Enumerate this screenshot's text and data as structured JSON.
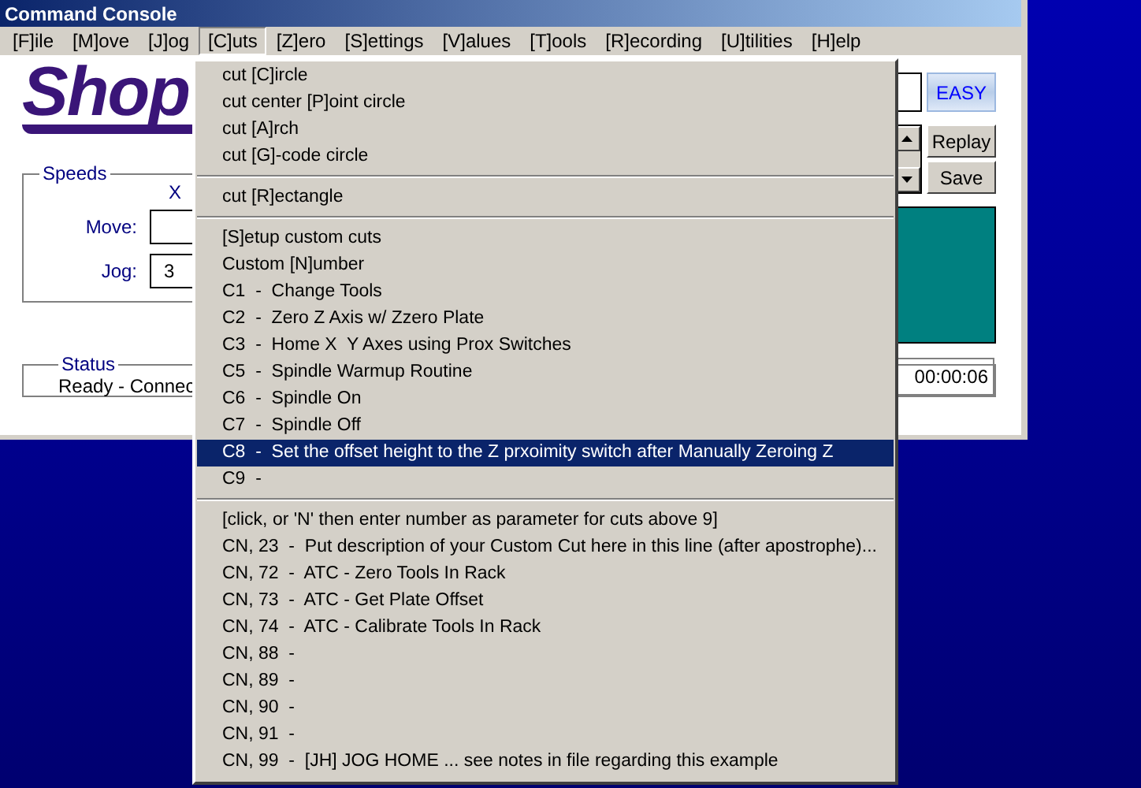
{
  "window": {
    "title": "Command Console"
  },
  "menu": [
    {
      "label": "[F]ile",
      "selected": false
    },
    {
      "label": "[M]ove",
      "selected": false
    },
    {
      "label": "[J]og",
      "selected": false
    },
    {
      "label": "[C]uts",
      "selected": true
    },
    {
      "label": "[Z]ero",
      "selected": false
    },
    {
      "label": "[S]ettings",
      "selected": false
    },
    {
      "label": "[V]alues",
      "selected": false
    },
    {
      "label": "[T]ools",
      "selected": false
    },
    {
      "label": "[R]ecording",
      "selected": false
    },
    {
      "label": "[U]tilities",
      "selected": false
    },
    {
      "label": "[H]elp",
      "selected": false
    }
  ],
  "logo": {
    "text": "Shop"
  },
  "speeds": {
    "title": "Speeds",
    "column_label": "X",
    "rows": [
      {
        "label": "Move:"
      },
      {
        "label": "Jog:",
        "value": "3"
      }
    ]
  },
  "mode_button": "EASY",
  "buttons": [
    "Replay",
    "Save"
  ],
  "status": {
    "title": "Status",
    "text": "Ready - Connec",
    "timer": "00:00:06"
  },
  "dropdown": [
    {
      "kind": "item",
      "label": "cut [C]ircle",
      "selected": false
    },
    {
      "kind": "item",
      "label": "cut center [P]oint circle",
      "selected": false
    },
    {
      "kind": "item",
      "label": "cut [A]rch",
      "selected": false
    },
    {
      "kind": "item",
      "label": "cut [G]-code circle",
      "selected": false
    },
    {
      "kind": "separator"
    },
    {
      "kind": "item",
      "label": "cut [R]ectangle",
      "selected": false
    },
    {
      "kind": "separator"
    },
    {
      "kind": "item",
      "label": "[S]etup custom cuts",
      "selected": false
    },
    {
      "kind": "item",
      "label": "Custom [N]umber",
      "selected": false
    },
    {
      "kind": "item",
      "label": "C1  -  Change Tools",
      "selected": false
    },
    {
      "kind": "item",
      "label": "C2  -  Zero Z Axis w/ Zzero Plate",
      "selected": false
    },
    {
      "kind": "item",
      "label": "C3  -  Home X  Y Axes using Prox Switches",
      "selected": false
    },
    {
      "kind": "item",
      "label": "C5  -  Spindle Warmup Routine",
      "selected": false
    },
    {
      "kind": "item",
      "label": "C6  -  Spindle On",
      "selected": false
    },
    {
      "kind": "item",
      "label": "C7  -  Spindle Off",
      "selected": false
    },
    {
      "kind": "item",
      "label": "C8  -  Set the offset height to the Z prxoimity switch after Manually Zeroing Z",
      "selected": true
    },
    {
      "kind": "item",
      "label": "C9  -",
      "selected": false
    },
    {
      "kind": "separator"
    },
    {
      "kind": "item",
      "label": "[click, or 'N' then enter number as parameter for cuts above 9]",
      "selected": false
    },
    {
      "kind": "item",
      "label": "CN, 23  -  Put description of your Custom Cut here in this line (after apostrophe)...",
      "selected": false
    },
    {
      "kind": "item",
      "label": "CN, 72  -  ATC - Zero Tools In Rack",
      "selected": false
    },
    {
      "kind": "item",
      "label": "CN, 73  -  ATC - Get Plate Offset",
      "selected": false
    },
    {
      "kind": "item",
      "label": "CN, 74  -  ATC - Calibrate Tools In Rack",
      "selected": false
    },
    {
      "kind": "item",
      "label": "CN, 88  -",
      "selected": false
    },
    {
      "kind": "item",
      "label": "CN, 89  -",
      "selected": false
    },
    {
      "kind": "item",
      "label": "CN, 90  -",
      "selected": false
    },
    {
      "kind": "item",
      "label": "CN, 91  -",
      "selected": false
    },
    {
      "kind": "item",
      "label": "CN, 99  -  [JH] JOG HOME ... see notes in file regarding this example",
      "selected": false
    }
  ]
}
